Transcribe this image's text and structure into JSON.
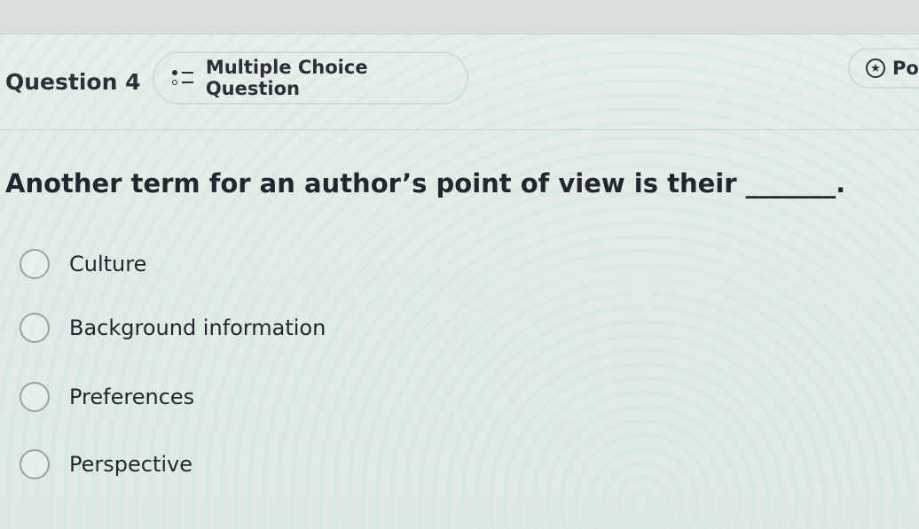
{
  "question": {
    "label": "Question 4",
    "type_label": "Multiple Choice Question",
    "type_icon": "list-icon",
    "points_label": "Po",
    "points_icon": "star-circle-icon",
    "prompt": "Another term for an author’s point of view is their _______."
  },
  "choices": [
    {
      "label": "Culture"
    },
    {
      "label": "Background information"
    },
    {
      "label": "Preferences"
    },
    {
      "label": "Perspective"
    }
  ],
  "colors": {
    "text": "#2b2f3a",
    "border": "#d4dad7",
    "radio_border": "#9aa1a8"
  }
}
